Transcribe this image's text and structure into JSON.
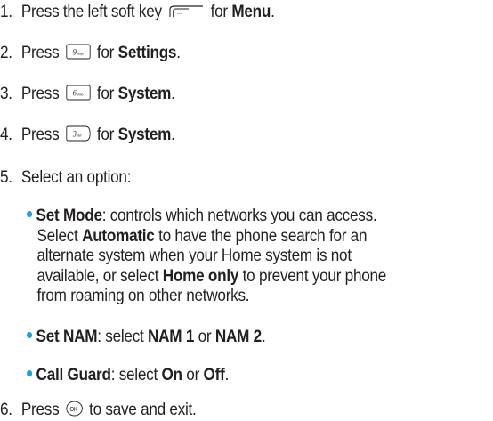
{
  "steps": [
    {
      "num": "1.",
      "pre": "Press the left soft key",
      "post": "for",
      "bold": "Menu",
      "tail": ".",
      "key_icon": "left-soft-key-icon"
    },
    {
      "num": "2.",
      "pre": "Press",
      "post": "for",
      "bold": "Settings",
      "tail": ".",
      "key_icon": "key-9-wxyz-icon",
      "key_label": "9",
      "key_sub": "wxyz"
    },
    {
      "num": "3.",
      "pre": "Press",
      "post": "for",
      "bold": "System",
      "tail": ".",
      "key_icon": "key-6-mno-icon",
      "key_label": "6",
      "key_sub": "mno"
    },
    {
      "num": "4.",
      "pre": "Press",
      "post": "for",
      "bold": "System",
      "tail": ".",
      "key_icon": "key-3-def-icon",
      "key_label": "3",
      "key_sub": "def"
    },
    {
      "num": "5.",
      "text": "Select an option:"
    },
    {
      "num": "6.",
      "pre": "Press",
      "post": "to save and exit.",
      "key_icon": "ok-key-icon",
      "key_label": "OK"
    }
  ],
  "options": [
    {
      "title": "Set Mode",
      "line1": ": controls which networks you can access.",
      "line2_pre": "Select",
      "line2_bold": "Automatic",
      "line2_post": "to have the phone search for an",
      "line3": "alternate system when your Home system is not",
      "line4_pre": "available, or select",
      "line4_bold": "Home only",
      "line4_post": "to prevent your phone",
      "line5": "from roaming on other networks."
    },
    {
      "title": "Set NAM",
      "pre": ": select",
      "bold1": "NAM 1",
      "mid": "or",
      "bold2": "NAM 2",
      "tail": "."
    },
    {
      "title": "Call Guard",
      "pre": ": select",
      "bold1": "On",
      "mid": "or",
      "bold2": "Off",
      "tail": "."
    }
  ],
  "colors": {
    "text": "#231f20",
    "bullet": "#1ba1e2"
  }
}
